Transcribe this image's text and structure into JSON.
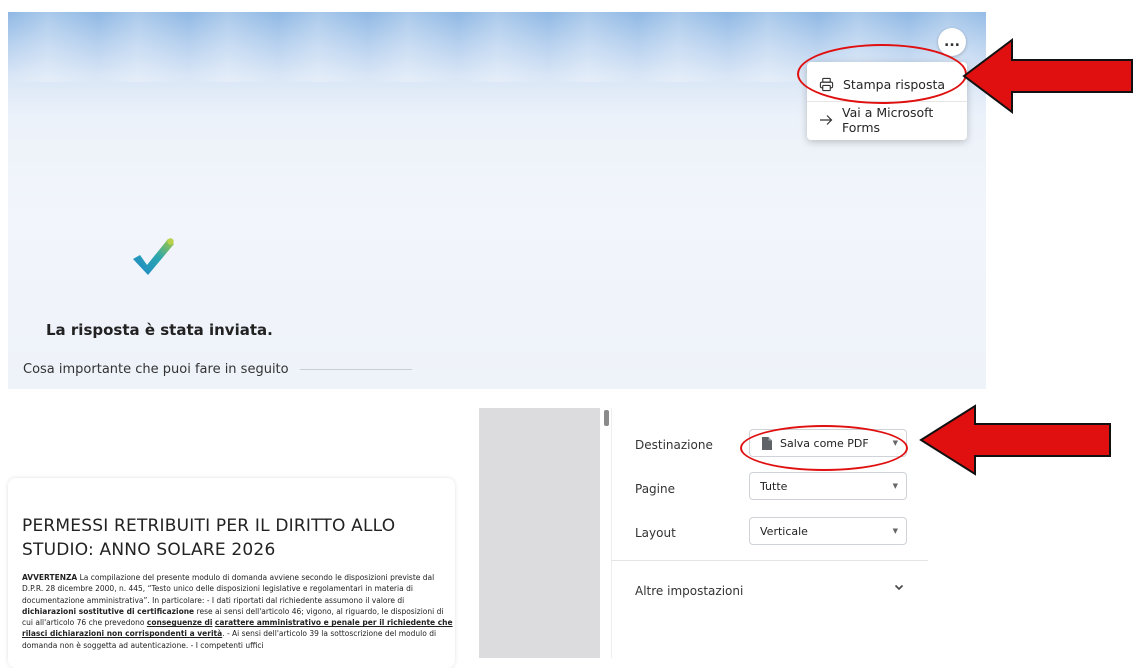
{
  "forms": {
    "menu": {
      "more_label": "...",
      "print_label": "Stampa risposta",
      "goto_label": "Vai a Microsoft Forms"
    },
    "confirmation_title": "La risposta è stata inviata.",
    "next_steps_label": "Cosa importante che puoi fare in seguito"
  },
  "document": {
    "title": "PERMESSI RETRIBUITI PER IL DIRITTO ALLO STUDIO: ANNO SOLARE 2026",
    "body": {
      "b1": "AVVERTENZA",
      "t1": " La compilazione del presente modulo di domanda avviene secondo le disposizioni previste dal D.P.R. 28 dicembre 2000, n. 445, “Testo unico delle disposizioni legislative e regolamentari in materia di documentazione amministrativa”. In particolare: -   I dati riportati dal richiedente assumono il valore di ",
      "b2": "dichiarazioni sostitutive di certificazione",
      "t2": " rese ai sensi dell'articolo 46; vigono, al riguardo, le disposizioni di cui all'articolo 76 che prevedono ",
      "u1": "conseguenze di",
      "t3": " ",
      "u2": "carattere amministrativo e penale per il richiedente che rilasci dichiarazioni non corrispondenti a verità",
      "t4": ".  -  Ai sensi dell'articolo 39 la sottoscrizione del modulo di domanda non è soggetta ad autenticazione.  -  I competenti uffici"
    }
  },
  "print_settings": {
    "destination_label": "Destinazione",
    "destination_value": "Salva come PDF",
    "pages_label": "Pagine",
    "pages_value": "Tutte",
    "layout_label": "Layout",
    "layout_value": "Verticale",
    "more_settings_label": "Altre impostazioni"
  },
  "annotation_color": "#e01010"
}
